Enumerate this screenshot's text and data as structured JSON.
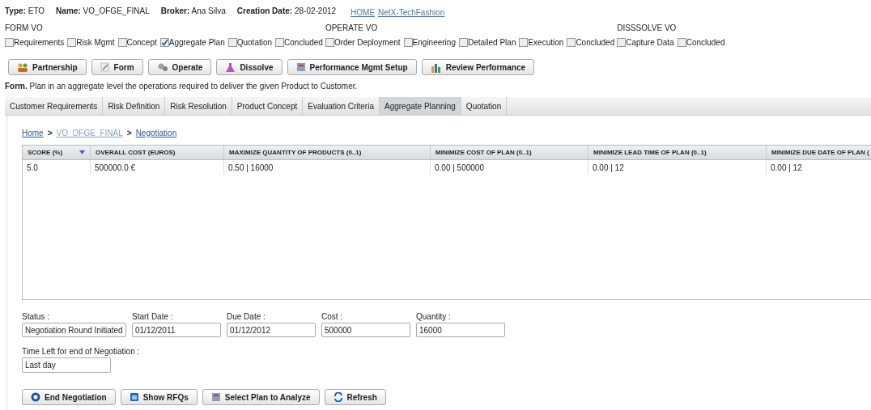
{
  "header": {
    "fields": [
      {
        "label": "Type:",
        "value": "ETO"
      },
      {
        "label": "Name:",
        "value": "VO_OFGE_FINAL"
      },
      {
        "label": "Broker:",
        "value": "Ana Silva"
      },
      {
        "label": "Creation Date:",
        "value": "28-02-2012"
      }
    ],
    "links": [
      "HOME",
      "NetX-TechFashion"
    ]
  },
  "phases": [
    {
      "title": "FORM VO",
      "steps": [
        {
          "label": "Requirements",
          "checked": false
        },
        {
          "label": "Risk Mgmt",
          "checked": false
        },
        {
          "label": "Concept",
          "checked": false
        },
        {
          "label": "Aggregate Plan",
          "checked": true
        },
        {
          "label": "Quotation",
          "checked": false
        },
        {
          "label": "Concluded",
          "checked": false
        }
      ]
    },
    {
      "title": "OPERATE VO",
      "steps": [
        {
          "label": "Order Deployment",
          "checked": false
        },
        {
          "label": "Engineering",
          "checked": false
        },
        {
          "label": "Detailed Plan",
          "checked": false
        },
        {
          "label": "Execution",
          "checked": false
        },
        {
          "label": "Concluded",
          "checked": false
        }
      ]
    },
    {
      "title": "DISSSOLVE VO",
      "steps": [
        {
          "label": "Capture Data",
          "checked": false
        },
        {
          "label": "Concluded",
          "checked": false
        }
      ]
    }
  ],
  "toolbar": [
    {
      "label": "Partnership"
    },
    {
      "label": "Form"
    },
    {
      "label": "Operate"
    },
    {
      "label": "Dissolve"
    },
    {
      "label": "Performance Mgmt Setup"
    },
    {
      "label": "Review Performance"
    }
  ],
  "description": {
    "lead": "Form.",
    "text": "Plan in an aggregate level the operations required to deliver the given Product to Customer."
  },
  "tabs": [
    {
      "label": "Customer Requirements",
      "selected": false
    },
    {
      "label": "Risk Definition",
      "selected": false
    },
    {
      "label": "Risk Resolution",
      "selected": false
    },
    {
      "label": "Product Concept",
      "selected": false
    },
    {
      "label": "Evaluation Criteria",
      "selected": false
    },
    {
      "label": "Aggregate Planning",
      "selected": true
    },
    {
      "label": "Quotation",
      "selected": false
    }
  ],
  "breadcrumb": [
    {
      "label": "Home",
      "disabled": false
    },
    {
      "label": "VO_OFGE_FINAL",
      "disabled": true
    },
    {
      "label": "Negotiation",
      "disabled": false
    }
  ],
  "breadcrumb_separator": ">",
  "table": {
    "columns": [
      "SCORE (%)",
      "OVERALL COST (EUROS)",
      "MAXIMIZE QUANTITY OF PRODUCTS (0..1)",
      "MINIMIZE COST OF PLAN (0..1)",
      "MINIMIZE LEAD TIME OF PLAN (0..1)",
      "MINIMIZE DUE DATE OF PLAN ("
    ],
    "rows": [
      [
        "5.0",
        "500000.0 €",
        "0.50 | 16000",
        "0.00 | 500000",
        "0.00 | 12",
        "0.00 | 12"
      ]
    ]
  },
  "fields": [
    {
      "label": "Status :",
      "value": "Negotiation Round Initiated"
    },
    {
      "label": "Start Date :",
      "value": "01/12/2011"
    },
    {
      "label": "Due Date :",
      "value": "01/12/2012"
    },
    {
      "label": "Cost :",
      "value": "500000"
    },
    {
      "label": "Quantity :",
      "value": "16000"
    }
  ],
  "time_left": {
    "label": "Time Left for end of Negotiation :",
    "value": "Last day"
  },
  "actions": [
    {
      "label": "End Negotiation"
    },
    {
      "label": "Show RFQs"
    },
    {
      "label": "Select Plan to Analyze"
    },
    {
      "label": "Refresh"
    }
  ]
}
